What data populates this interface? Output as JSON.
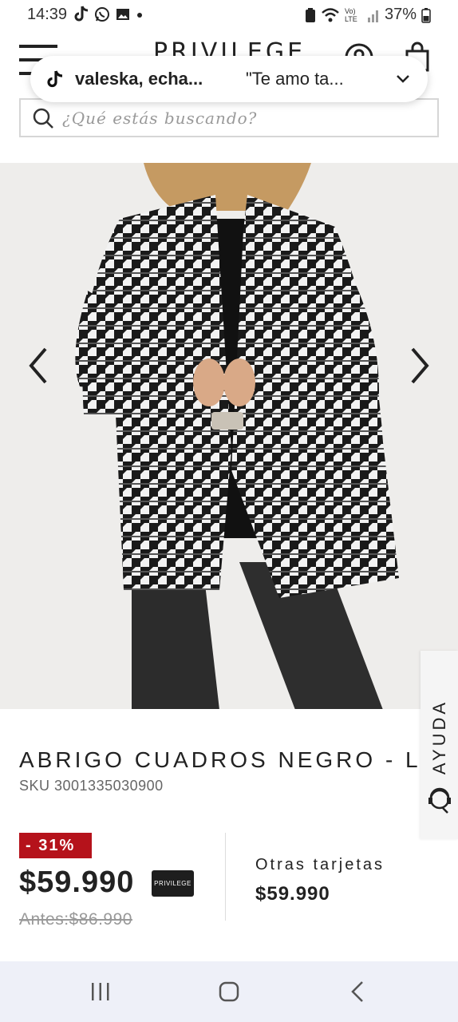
{
  "status_bar": {
    "time": "14:39",
    "battery": "37%",
    "network_label": "Vo) LTE"
  },
  "header": {
    "brand": "PRIVILEGE"
  },
  "notification": {
    "app_icon": "tiktok-icon",
    "title": "valeska, echa...",
    "message": "\"Te amo ta..."
  },
  "search": {
    "placeholder": "¿Qué estás buscando?"
  },
  "help_tab": {
    "label": "AYUDA"
  },
  "product": {
    "title": "ABRIGO CUADROS NEGRO - L",
    "sku": "SKU 3001335030900",
    "discount": "- 31%",
    "price": "$59.990",
    "card_label": "PRIVILEGE",
    "price_before": "Antes:$86.990",
    "other_cards_label": "Otras tarjetas",
    "other_cards_price": "$59.990"
  },
  "colors": {
    "discount_red": "#b5121b",
    "text_dark": "#222222",
    "gallery_bg": "#eeedeb"
  }
}
